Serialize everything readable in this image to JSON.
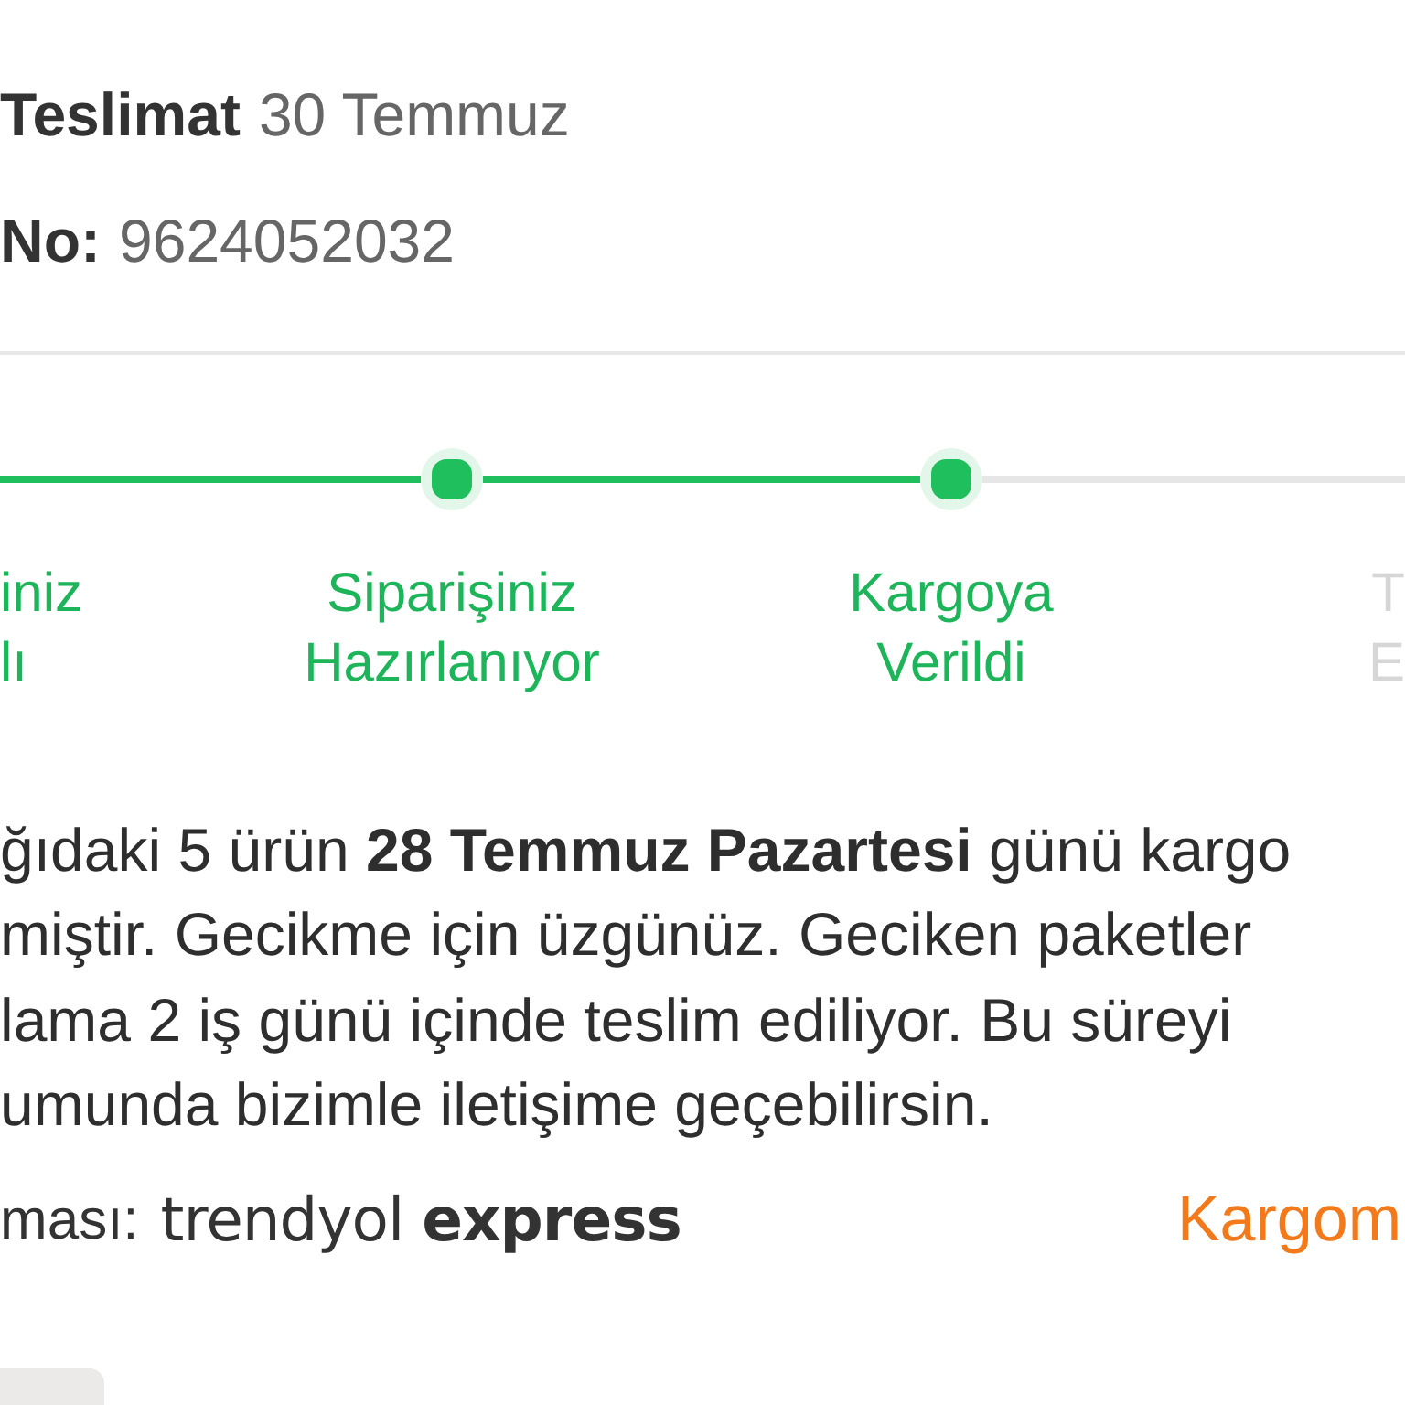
{
  "delivery": {
    "label": "Teslimat",
    "date": "30 Temmuz"
  },
  "order_number": {
    "label": "No:",
    "value": "9624052032"
  },
  "steps": [
    {
      "kind": "edge_left",
      "label_lines": [
        "iniz",
        "lı"
      ],
      "done": true
    },
    {
      "kind": "node",
      "label_lines": [
        "Siparişiniz",
        "Hazırlanıyor"
      ],
      "done": true
    },
    {
      "kind": "node",
      "label_lines": [
        "Kargoya",
        "Verildi"
      ],
      "done": true
    },
    {
      "kind": "edge_right",
      "label_lines": [
        "T",
        "E"
      ],
      "done": false
    }
  ],
  "message_lines": [
    "ğıdaki 5 ürün **28 Temmuz Pazartesi** günü kargo",
    "miştir. Gecikme için üzgünüz. Geciken paketler",
    "lama 2 iş günü içinde teslim ediliyor. Bu süreyi",
    "umunda bizimle iletişime geçebilirsin."
  ],
  "shipping": {
    "label": "ması:",
    "logo": "trendyol **express**",
    "link": "Kargom"
  }
}
